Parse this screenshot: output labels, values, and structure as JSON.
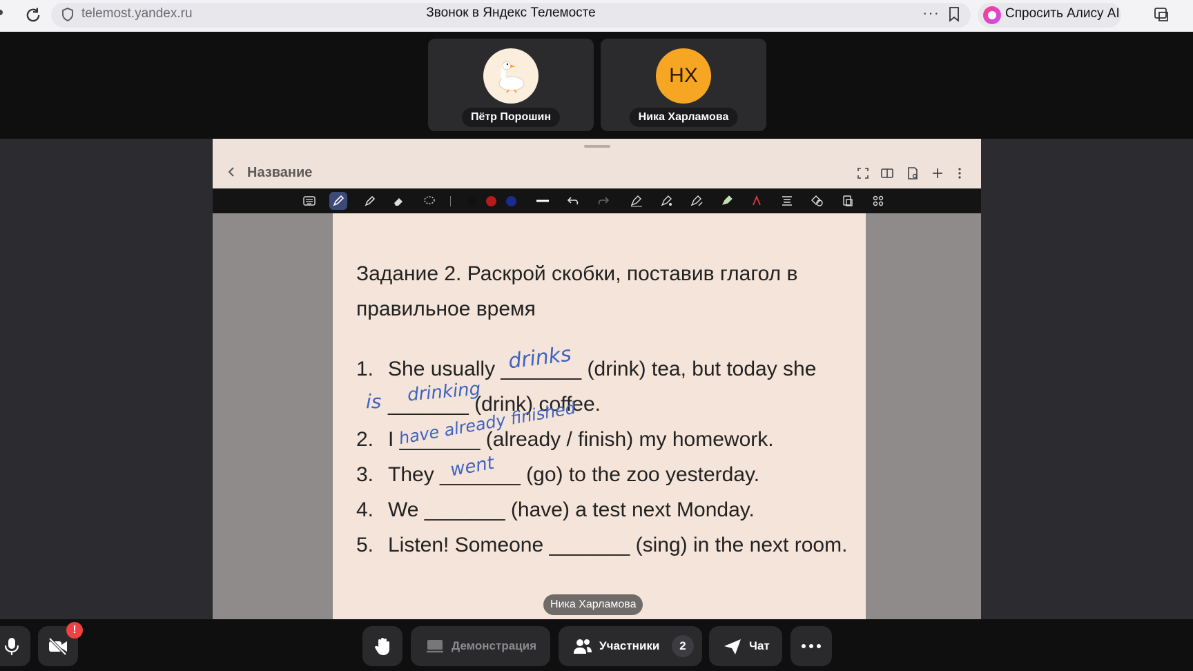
{
  "browser": {
    "url": "telemost.yandex.ru",
    "page_title": "Звонок в Яндекс Телемосте",
    "more_label": "···",
    "alice_label": "Спросить Алису AI"
  },
  "participants": [
    {
      "name": "Пётр Порошин",
      "avatar": "goose-avatar"
    },
    {
      "name": "Ника Харламова",
      "initials": "НХ",
      "avatar_color": "#f6a623"
    }
  ],
  "board": {
    "title": "Название",
    "colors": [
      "#111111",
      "#b51b1b",
      "#1d2b8f"
    ],
    "task_title": "Задание 2. Раскрой скобки, поставив глагол в правильное время",
    "items": [
      {
        "num": "1.",
        "text": "She usually _______ (drink) tea, but today she _______ (drink) coffee."
      },
      {
        "num": "2.",
        "text": "I _______ (already / finish) my homework."
      },
      {
        "num": "3.",
        "text": "They _______ (go) to the zoo yesterday."
      },
      {
        "num": "4.",
        "text": "We _______ (have) a test next Monday."
      },
      {
        "num": "5.",
        "text": "Listen! Someone _______ (sing) in the next room."
      }
    ],
    "handwriting": [
      "drinks",
      "is",
      "drinking",
      "have already finished",
      "went"
    ],
    "cursor_name": "Ника Харламова"
  },
  "bottom": {
    "alert": "!",
    "demo_label": "Демонстрация",
    "participants_label": "Участники",
    "participants_count": "2",
    "chat_label": "Чат"
  }
}
